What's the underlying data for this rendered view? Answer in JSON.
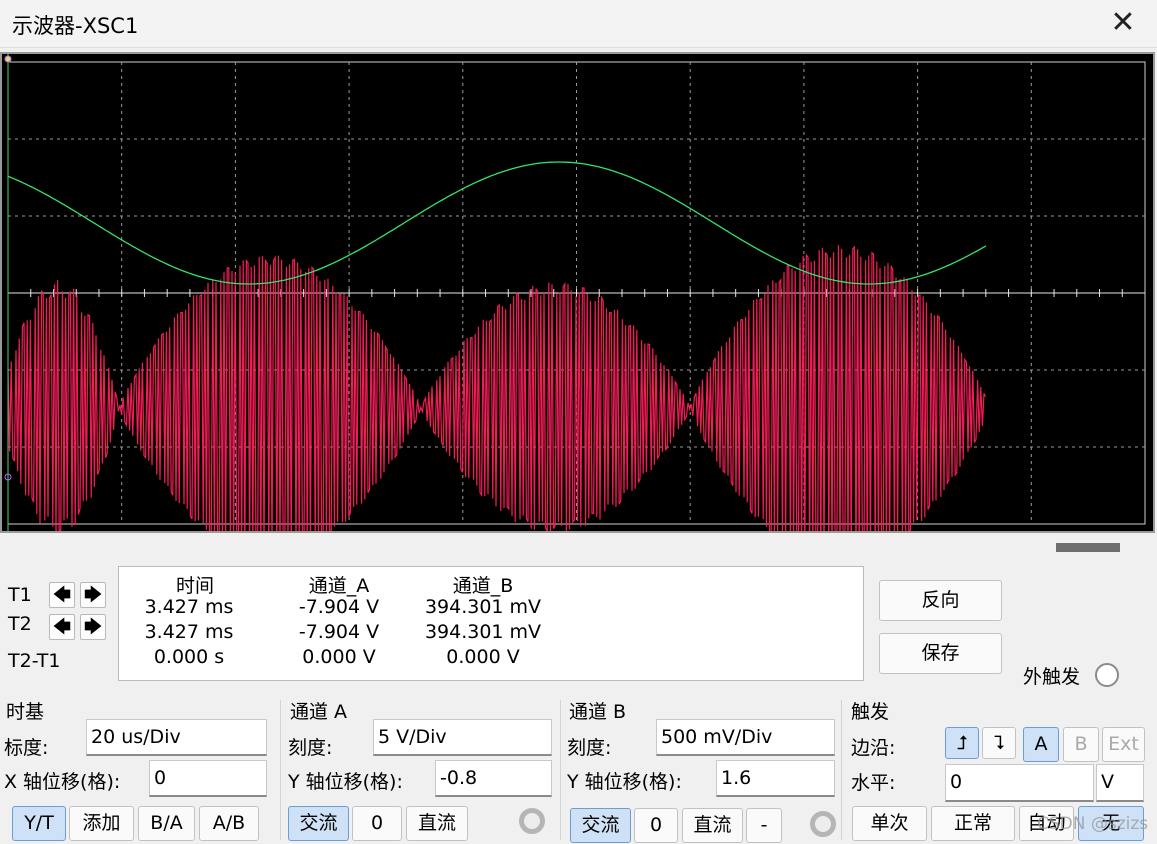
{
  "window": {
    "title": "示波器-XSC1",
    "close_glyph": "✕"
  },
  "colors": {
    "trace_a": "#ff1f5a",
    "trace_b": "#35e36a",
    "screen_bg": "#000000",
    "grid": "#9a9a9a"
  },
  "cursors": {
    "t1_label": "T1",
    "t2_label": "T2",
    "diff_label": "T2-T1",
    "left_arrow": "🡄",
    "right_arrow": "🡆"
  },
  "readout": {
    "headers": {
      "time": "时间",
      "ch_a": "通道_A",
      "ch_b": "通道_B"
    },
    "rows": [
      {
        "time": "3.427 ms",
        "ch_a": "-7.904 V",
        "ch_b": "394.301 mV"
      },
      {
        "time": "3.427 ms",
        "ch_a": "-7.904 V",
        "ch_b": "394.301 mV"
      },
      {
        "time": "0.000 s",
        "ch_a": "0.000 V",
        "ch_b": "0.000 V"
      }
    ]
  },
  "side_buttons": {
    "reverse": "反向",
    "save": "保存",
    "ext_trigger": "外触发"
  },
  "timebase": {
    "title": "时基",
    "scale_label": "标度:",
    "scale_value": "20 us/Div",
    "xpos_label": "X 轴位移(格):",
    "xpos_value": "0",
    "modes": [
      "Y/T",
      "添加",
      "B/A",
      "A/B"
    ],
    "active_mode": "Y/T"
  },
  "channel_a": {
    "title": "通道 A",
    "scale_label": "刻度:",
    "scale_value": "5  V/Div",
    "ypos_label": "Y 轴位移(格):",
    "ypos_value": "-0.8",
    "coupling": [
      "交流",
      "0",
      "直流"
    ],
    "active_coupling": "交流"
  },
  "channel_b": {
    "title": "通道 B",
    "scale_label": "刻度:",
    "scale_value": "500 mV/Div",
    "ypos_label": "Y 轴位移(格):",
    "ypos_value": "1.6",
    "coupling": [
      "交流",
      "0",
      "直流",
      "-"
    ],
    "active_coupling": "交流"
  },
  "trigger": {
    "title": "触发",
    "edge_label": "边沿:",
    "edge_rise_glyph": "⮥",
    "edge_fall_glyph": "⮧",
    "sources": [
      "A",
      "B",
      "Ext"
    ],
    "active_source": "A",
    "level_label": "水平:",
    "level_value": "0",
    "level_unit": "V",
    "modes": [
      "单次",
      "正常",
      "自动",
      "无"
    ],
    "active_mode": "无"
  },
  "watermark": "CSDN @szizs"
}
